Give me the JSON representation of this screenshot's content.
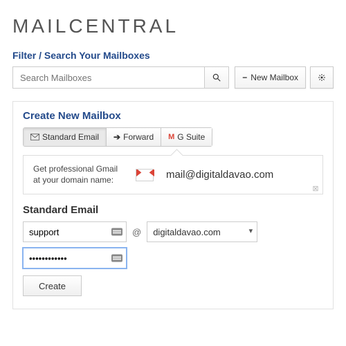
{
  "brand": "MAILCENTRAL",
  "filter_title": "Filter / Search Your Mailboxes",
  "search": {
    "placeholder": "Search Mailboxes"
  },
  "toolbar": {
    "new_mailbox_label": "New Mailbox"
  },
  "panel": {
    "title": "Create New Mailbox",
    "tabs": {
      "standard": "Standard Email",
      "forward": "Forward",
      "gsuite": "G Suite"
    },
    "promo": {
      "text": "Get professional Gmail at your domain name:",
      "email": "mail@digitaldavao.com"
    },
    "section_title": "Standard Email",
    "form": {
      "local_value": "support",
      "at": "@",
      "domain_value": "digitaldavao.com",
      "password_value": "••••••••••••",
      "create_label": "Create"
    }
  }
}
